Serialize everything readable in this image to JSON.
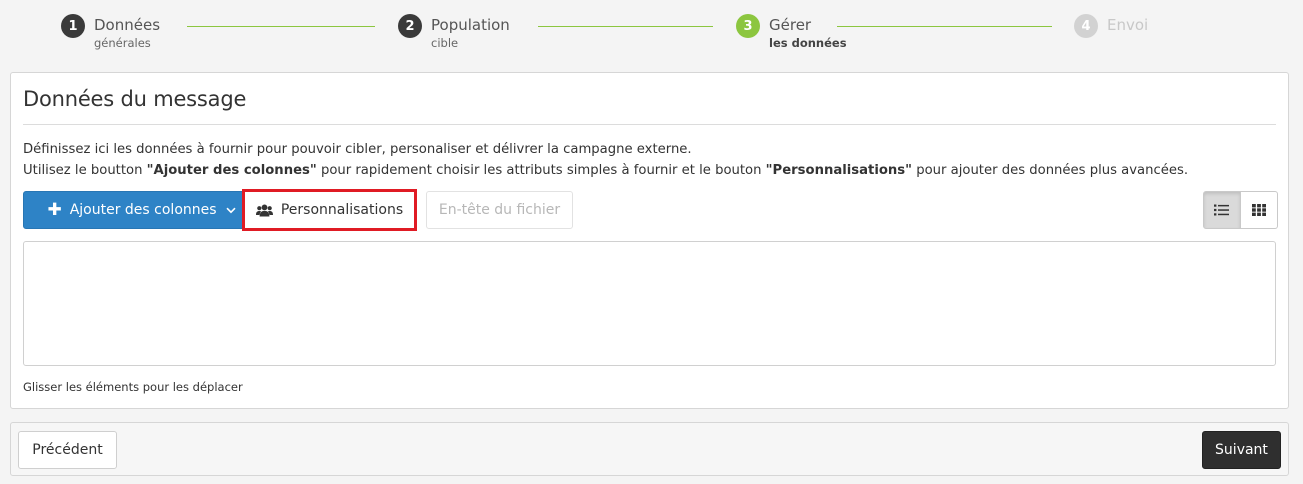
{
  "stepper": {
    "steps": [
      {
        "number": "1",
        "title": "Données",
        "subtitle": "générales",
        "state": "done"
      },
      {
        "number": "2",
        "title": "Population",
        "subtitle": "cible",
        "state": "done"
      },
      {
        "number": "3",
        "title": "Gérer",
        "subtitle": "les données",
        "state": "active"
      },
      {
        "number": "4",
        "title": "Envoi",
        "subtitle": "",
        "state": "disabled"
      }
    ],
    "colors": {
      "done": "#3a3a3a",
      "active": "#8cc63f",
      "disabled": "#d2d2d2"
    }
  },
  "panel": {
    "title": "Données du message",
    "desc_line1": "Définissez ici les données à fournir pour pouvoir cibler, personaliser et délivrer la campagne externe.",
    "desc_line2_a": "Utilisez le boutton ",
    "desc_line2_b": "\"Ajouter des colonnes\"",
    "desc_line2_c": " pour rapidement choisir les attributs simples à fournir et le bouton ",
    "desc_line2_d": "\"Personnalisations\"",
    "desc_line2_e": " pour ajouter des données plus avancées.",
    "hint": "Glisser les éléments pour les déplacer"
  },
  "toolbar": {
    "add_columns_label": "Ajouter des colonnes",
    "add_columns_icon": "plus-icon",
    "add_columns_caret": "chevron-down-icon",
    "personalizations_label": "Personnalisations",
    "personalizations_icon": "users-icon",
    "file_header_label": "En-tête du fichier",
    "view_list_icon": "list-view-icon",
    "view_grid_icon": "grid-view-icon",
    "accent": "#2e83c6",
    "highlight": "#e01b24"
  },
  "footer": {
    "prev_label": "Précédent",
    "next_label": "Suivant"
  }
}
